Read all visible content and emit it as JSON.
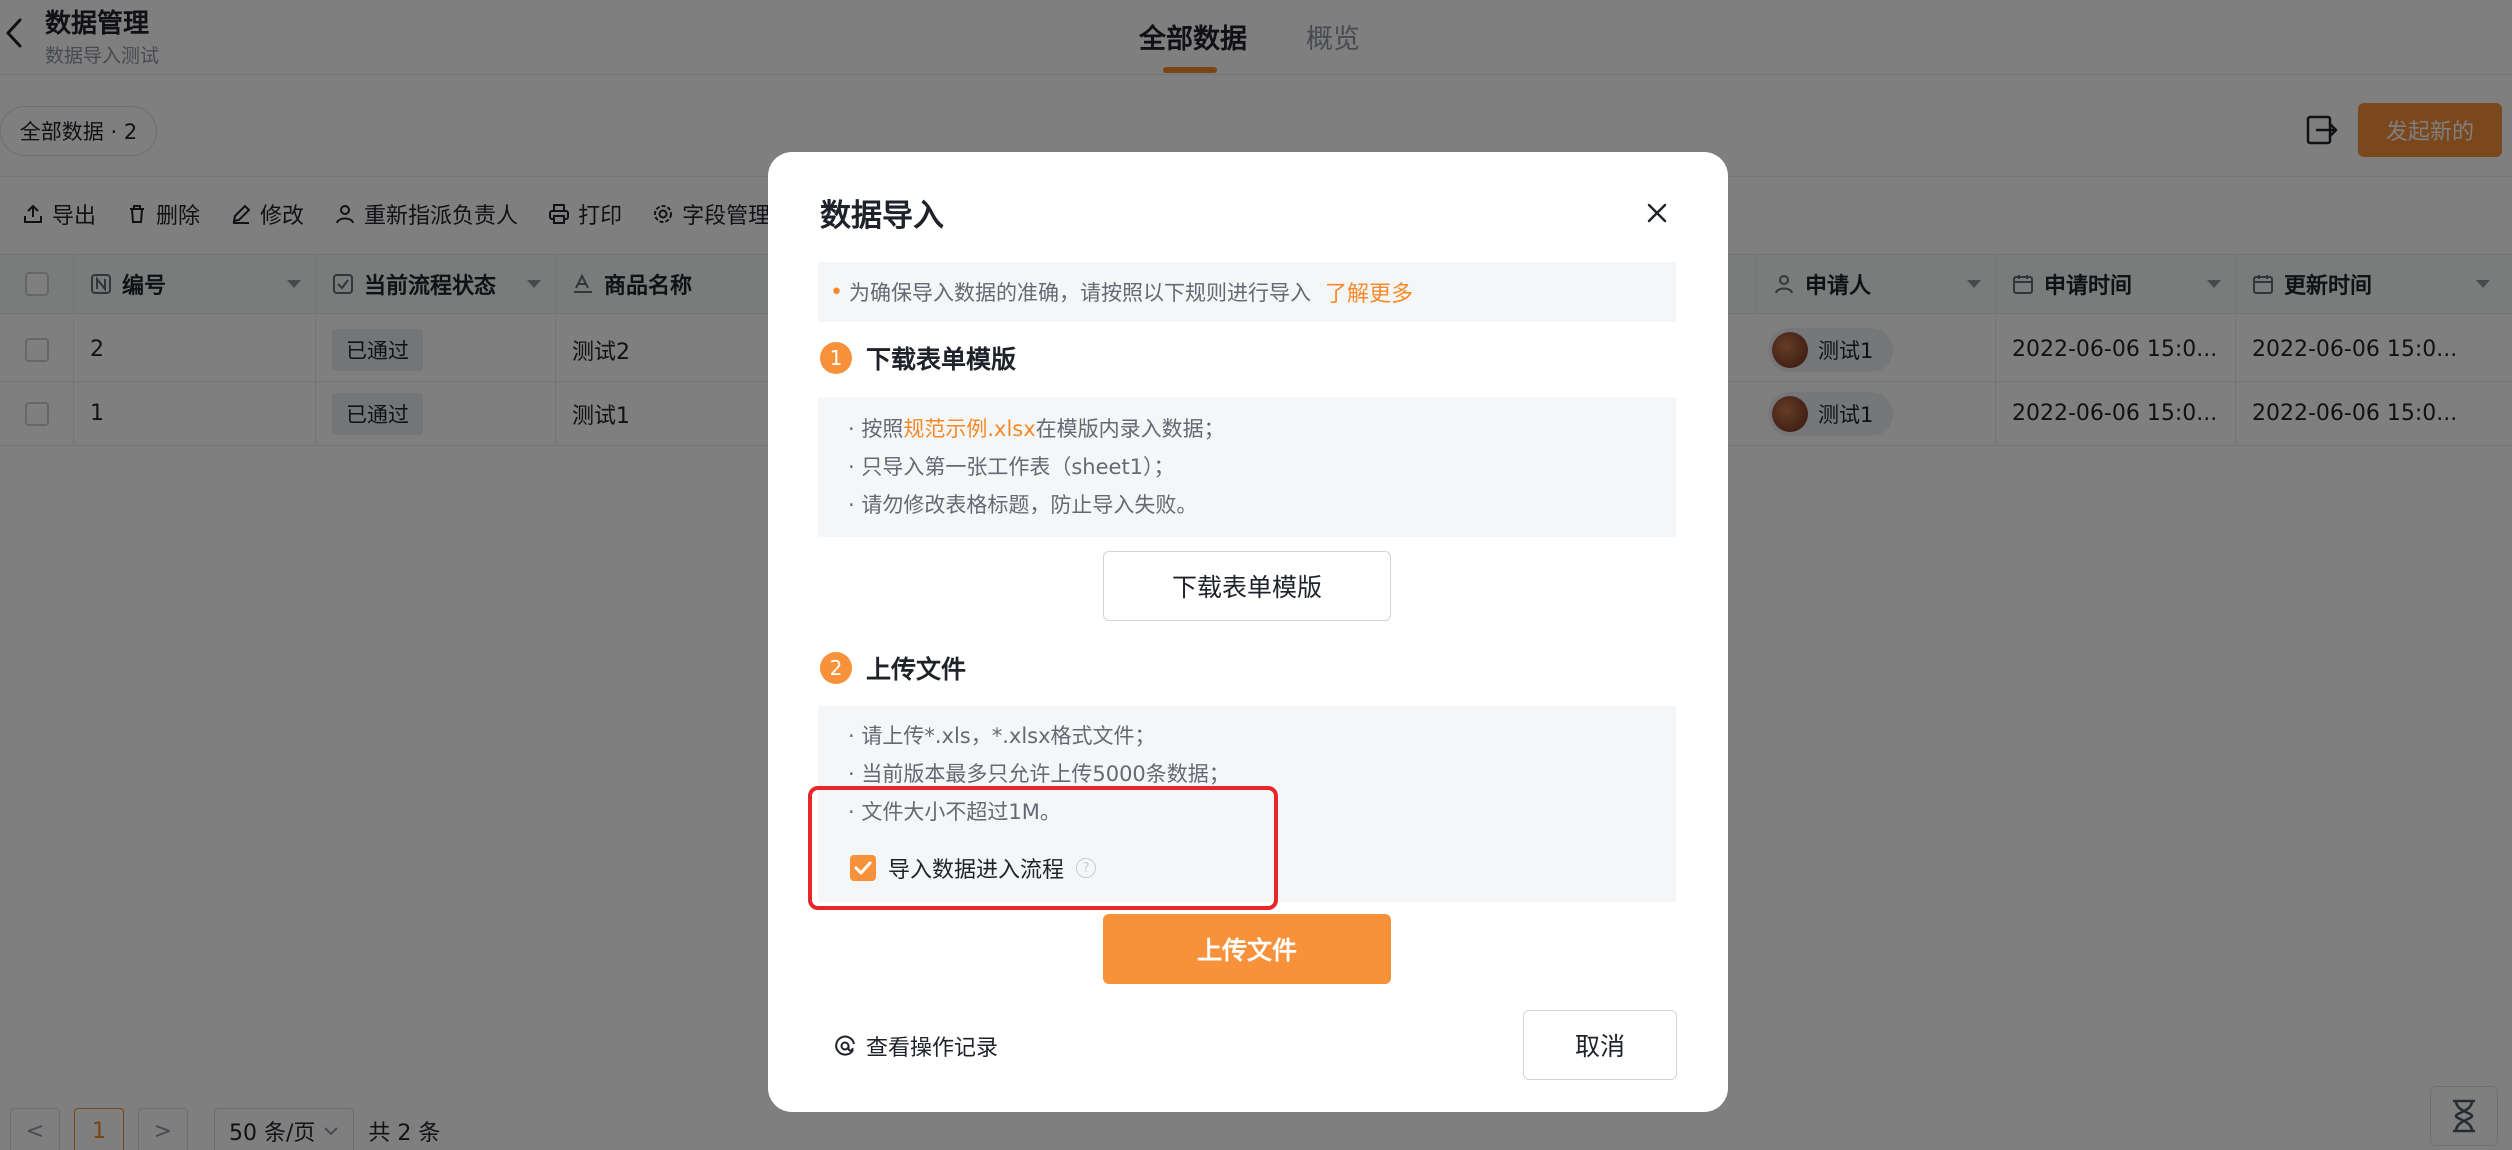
{
  "header": {
    "title": "数据管理",
    "subtitle": "数据导入测试",
    "tabs": [
      {
        "label": "全部数据",
        "active": true
      },
      {
        "label": "概览",
        "active": false
      }
    ]
  },
  "view": {
    "pill_label": "全部数据 · 2",
    "launch_button": "发起新的"
  },
  "toolbar": {
    "items": [
      {
        "label": "导出",
        "icon": "export-icon"
      },
      {
        "label": "删除",
        "icon": "trash-icon"
      },
      {
        "label": "修改",
        "icon": "edit-icon"
      },
      {
        "label": "重新指派负责人",
        "icon": "user-icon"
      },
      {
        "label": "打印",
        "icon": "printer-icon"
      },
      {
        "label": "字段管理",
        "icon": "gear-icon"
      }
    ]
  },
  "table": {
    "columns": [
      "编号",
      "当前流程状态",
      "商品名称",
      "申请人",
      "申请时间",
      "更新时间"
    ],
    "rows": [
      {
        "id": "2",
        "status": "已通过",
        "product": "测试2",
        "applicant": "测试1",
        "applied_at": "2022-06-06 15:0...",
        "updated_at": "2022-06-06 15:0..."
      },
      {
        "id": "1",
        "status": "已通过",
        "product": "测试1",
        "applicant": "测试1",
        "applied_at": "2022-06-06 15:0...",
        "updated_at": "2022-06-06 15:0..."
      }
    ]
  },
  "pagination": {
    "prev": "<",
    "current_page": "1",
    "next": ">",
    "page_size": "50 条/页",
    "total": "共 2 条"
  },
  "modal": {
    "title": "数据导入",
    "notice": "为确保导入数据的准确，请按照以下规则进行导入",
    "notice_link": "了解更多",
    "step1": {
      "number": "1",
      "title": "下载表单模版",
      "rule1_prefix": "· 按照",
      "rule1_link": "规范示例.xlsx",
      "rule1_suffix": "在模版内录入数据；",
      "rule2": "· 只导入第一张工作表（sheet1）；",
      "rule3": "· 请勿修改表格标题，防止导入失败。",
      "button": "下载表单模版"
    },
    "step2": {
      "number": "2",
      "title": "上传文件",
      "rule1": "· 请上传*.xls，*.xlsx格式文件；",
      "rule2": "· 当前版本最多只允许上传5000条数据；",
      "rule3": "· 文件大小不超过1M。",
      "checkbox_label": "导入数据进入流程",
      "checkbox_checked": true,
      "button": "上传文件"
    },
    "history_link": "查看操作记录",
    "cancel_button": "取消"
  },
  "colors": {
    "accent": "#f7913a",
    "highlight": "#e8262c"
  }
}
